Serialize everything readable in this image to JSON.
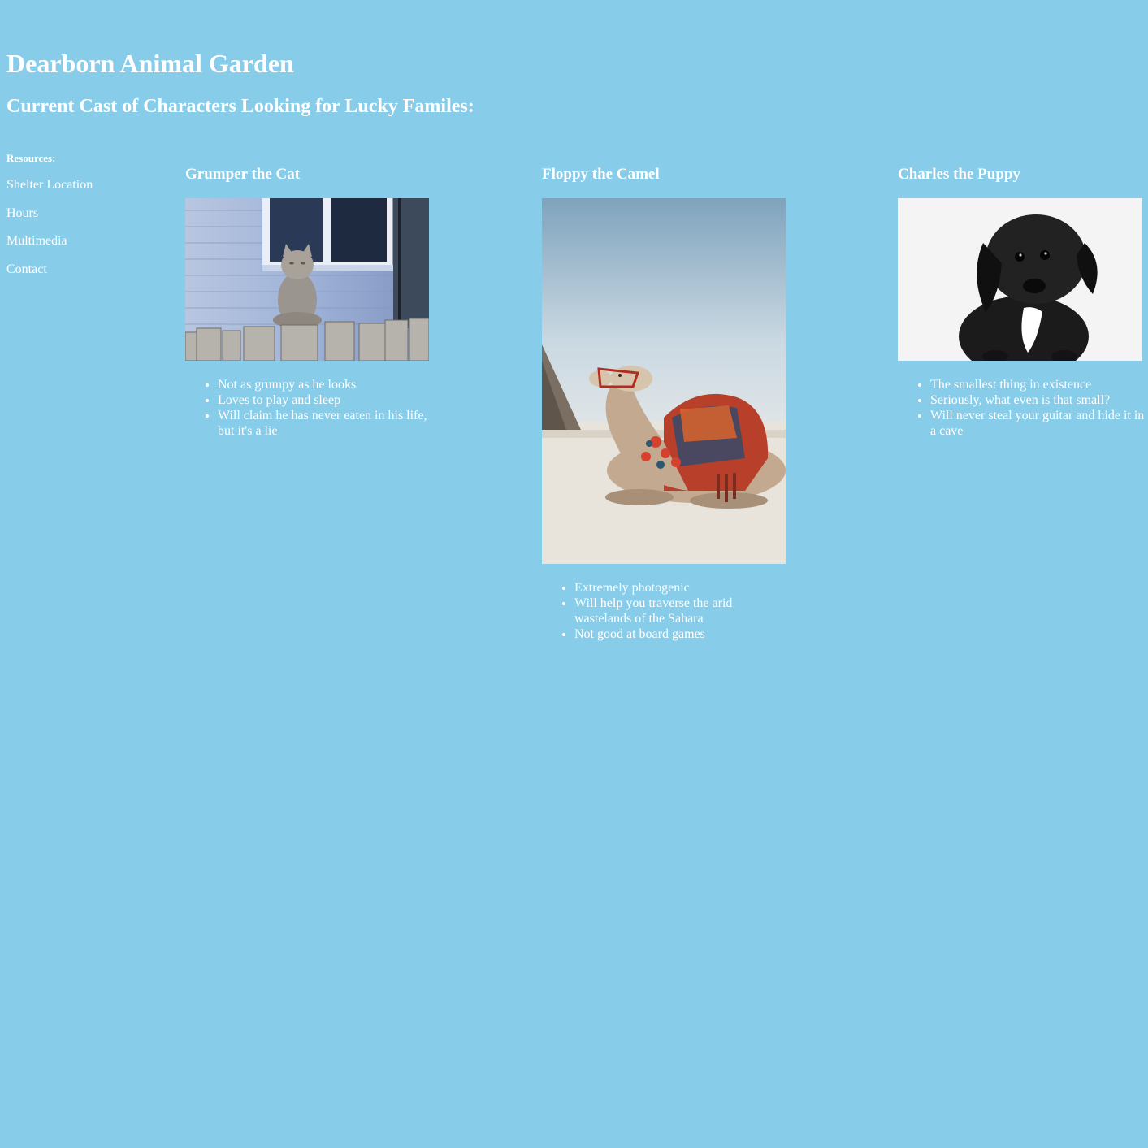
{
  "header": {
    "title": "Dearborn Animal Garden",
    "subtitle": "Current Cast of Characters Looking for Lucky Familes:"
  },
  "sidebar": {
    "heading": "Resources:",
    "links": [
      {
        "label": "Shelter Location"
      },
      {
        "label": "Hours"
      },
      {
        "label": "Multimedia"
      },
      {
        "label": "Contact"
      }
    ]
  },
  "animals": [
    {
      "name": "Grumper the Cat",
      "traits": [
        "Not as grumpy as he looks",
        "Loves to play and sleep",
        "Will claim he has never eaten in his life, but it's a lie"
      ]
    },
    {
      "name": "Floppy the Camel",
      "traits": [
        "Extremely photogenic",
        "Will help you traverse the arid wastelands of the Sahara",
        "Not good at board games"
      ]
    },
    {
      "name": "Charles the Puppy",
      "traits": [
        "The smallest thing in existence",
        "Seriously, what even is that small?",
        "Will never steal your guitar and hide it in a cave"
      ]
    }
  ],
  "colors": {
    "background": "#87CDE9",
    "text": "#ffffff"
  }
}
